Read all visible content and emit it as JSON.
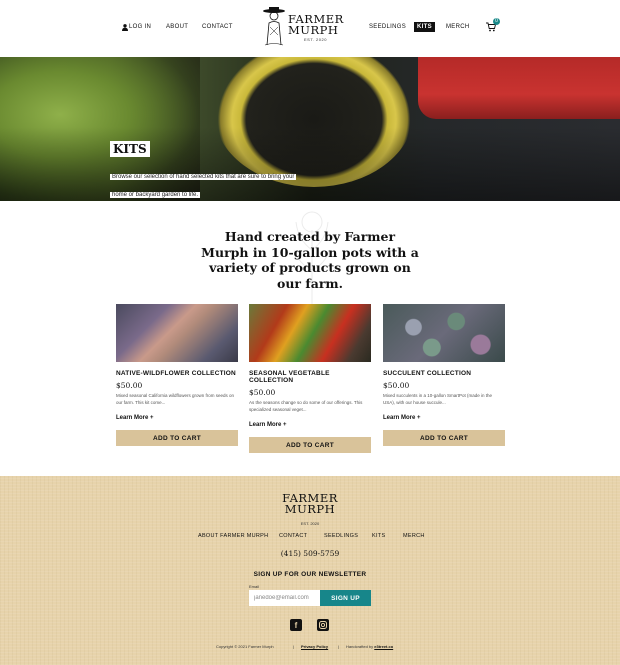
{
  "header": {
    "nav_left": [
      "LOG IN",
      "ABOUT",
      "CONTACT"
    ],
    "nav_right": [
      "SEEDLINGS",
      "KITS",
      "MERCH"
    ],
    "logo_text_1": "FARMER",
    "logo_text_2": "MURPH",
    "logo_est": "EST. 2020",
    "cart_count": "0",
    "accent": "#1a8a8a"
  },
  "hero": {
    "title": "KITS",
    "subtitle": "Browse our selection of hand selected kits that are sure to bring your home or backyard garden to life."
  },
  "intro": {
    "text": "Hand created by Farmer Murph in 10-gallon pots with a variety of products grown on our farm."
  },
  "products": [
    {
      "name": "NATIVE-WILDFLOWER COLLECTION",
      "price": "$50.00",
      "description": "Mixed seasonal California wildflowers grown from seeds on our farm. This kit come...",
      "learn_more": "Learn More",
      "button": "ADD TO CART"
    },
    {
      "name": "SEASONAL VEGETABLE COLLECTION",
      "price": "$50.00",
      "description": "As the seasons change so do some of our offerings. This specialized seasonal veget...",
      "learn_more": "Learn More",
      "button": "ADD TO CART"
    },
    {
      "name": "SUCCULENT COLLECTION",
      "price": "$50.00",
      "description": "Mixed succulents in a 10-gallon SmartPot (made in the USA), with our house succule...",
      "learn_more": "Learn More",
      "button": "ADD TO CART"
    }
  ],
  "footer": {
    "logo_text_1": "FARMER",
    "logo_text_2": "MURPH",
    "logo_est": "EST. 2020",
    "nav": [
      "ABOUT FARMER MURPH",
      "CONTACT",
      "SEEDLINGS",
      "KITS",
      "MERCH"
    ],
    "phone": "(415) 509-5759",
    "newsletter_title": "SIGN UP FOR OUR NEWSLETTER",
    "email_label": "Email",
    "email_placeholder": "janedoe@email.com",
    "signup_button": "SIGN UP",
    "signup_color": "#17868a",
    "copyright": "Copyright © 2021 Farmer Murph",
    "privacy": "Privacy Policy",
    "handcrafted_prefix": "Handcrafted by",
    "handcrafted_link": "e3treet.co"
  }
}
